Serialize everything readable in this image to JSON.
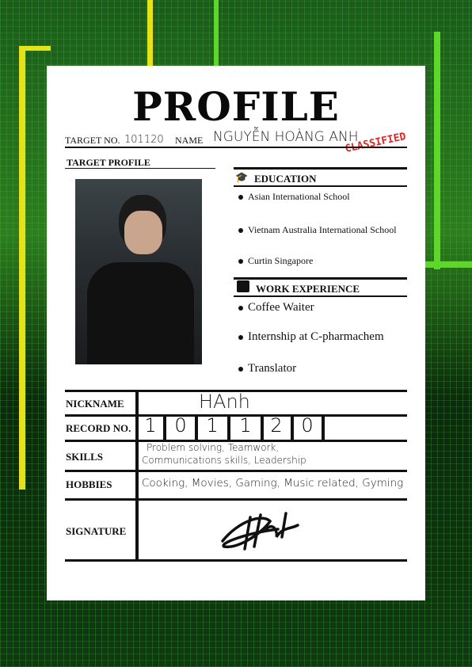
{
  "title": "PROFILE",
  "target_no_label": "TARGET NO.",
  "target_no": "101120",
  "name_label": "NAME",
  "name": "NGUYỄN HOÀNG ANH",
  "stamp": "CLASSIFIED",
  "target_profile_label": "TARGET PROFILE",
  "education": {
    "heading": "EDUCATION",
    "items": [
      "Asian International School",
      "Vietnam Australia International School",
      "Curtin Singapore"
    ]
  },
  "work": {
    "heading": "WORK EXPERIENCE",
    "items": [
      "Coffee Waiter",
      "Internship at C-pharmachem",
      "Translator"
    ]
  },
  "table": {
    "nickname_label": "NICKNAME",
    "nickname": "HAnh",
    "record_label": "RECORD NO.",
    "record_digits": [
      "1",
      "0",
      "1",
      "1",
      "2",
      "0"
    ],
    "skills_label": "SKILLS",
    "skills_line1": "Problem solving, Teamwork,",
    "skills_line2": "Communications skills, Leadership",
    "hobbies_label": "HOBBIES",
    "hobbies": "Cooking, Movies, Gaming, Music related, Gyming",
    "signature_label": "SIGNATURE"
  }
}
